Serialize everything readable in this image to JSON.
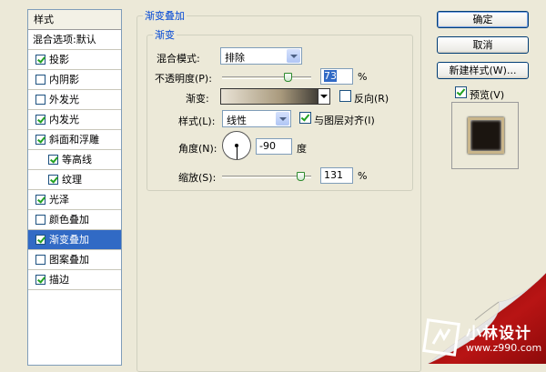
{
  "sidebar": {
    "header": "样式",
    "blend_options": "混合选项:默认",
    "items": [
      {
        "label": "投影",
        "checked": true,
        "indent": false,
        "selected": false
      },
      {
        "label": "内阴影",
        "checked": false,
        "indent": false,
        "selected": false
      },
      {
        "label": "外发光",
        "checked": false,
        "indent": false,
        "selected": false
      },
      {
        "label": "内发光",
        "checked": true,
        "indent": false,
        "selected": false
      },
      {
        "label": "斜面和浮雕",
        "checked": true,
        "indent": false,
        "selected": false
      },
      {
        "label": "等高线",
        "checked": true,
        "indent": true,
        "selected": false
      },
      {
        "label": "纹理",
        "checked": true,
        "indent": true,
        "selected": false
      },
      {
        "label": "光泽",
        "checked": true,
        "indent": false,
        "selected": false
      },
      {
        "label": "颜色叠加",
        "checked": false,
        "indent": false,
        "selected": false
      },
      {
        "label": "渐变叠加",
        "checked": true,
        "indent": false,
        "selected": true
      },
      {
        "label": "图案叠加",
        "checked": false,
        "indent": false,
        "selected": false
      },
      {
        "label": "描边",
        "checked": true,
        "indent": false,
        "selected": false
      }
    ]
  },
  "panel": {
    "group_title": "渐变叠加",
    "sub_title": "渐变",
    "blend_mode_label": "混合模式:",
    "blend_mode_value": "排除",
    "opacity_label": "不透明度(P):",
    "opacity_value": "73",
    "opacity_fraction": 0.73,
    "percent": "%",
    "gradient_label": "渐变:",
    "gradient_colors": [
      "#e9e3d6",
      "#a99a7d",
      "#222222"
    ],
    "reverse_label": "反向(R)",
    "reverse_checked": false,
    "style_label": "样式(L):",
    "style_value": "线性",
    "align_label": "与图层对齐(I)",
    "align_checked": true,
    "angle_label": "角度(N):",
    "angle_value": "-90",
    "angle_unit": "度",
    "scale_label": "缩放(S):",
    "scale_value": "131",
    "scale_fraction": 0.873
  },
  "buttons": {
    "ok": "确定",
    "cancel": "取消",
    "new_style": "新建样式(W)...",
    "preview_label": "预览(V)",
    "preview_checked": true
  },
  "watermark": {
    "name": "小林设计",
    "url": "www.z990.com"
  },
  "colors": {
    "accent": "#316ac5",
    "legend": "#0046d5",
    "curl_red": "#b01010"
  }
}
